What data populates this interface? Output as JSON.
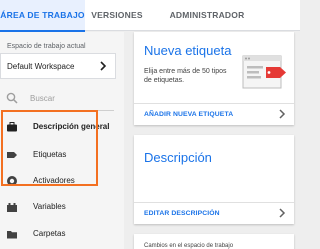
{
  "tabs": [
    {
      "label": "ÁREA DE TRABAJO",
      "active": true
    },
    {
      "label": "VERSIONES",
      "active": false
    },
    {
      "label": "ADMINISTRADOR",
      "active": false
    }
  ],
  "sidebar": {
    "workspace_label": "Espacio de trabajo actual",
    "workspace_name": "Default Workspace",
    "search_placeholder": "Buscar",
    "items": [
      {
        "label": "Descripción general",
        "icon": "briefcase-icon",
        "bold": true
      },
      {
        "label": "Etiquetas",
        "icon": "tag-icon"
      },
      {
        "label": "Activadores",
        "icon": "trigger-icon"
      },
      {
        "label": "Variables",
        "icon": "variables-icon"
      },
      {
        "label": "Carpetas",
        "icon": "folder-icon"
      }
    ],
    "highlight_color": "#f37021"
  },
  "cards": {
    "new_tag": {
      "title": "Nueva etiqueta",
      "text": "Elija entre más de 50 tipos de etiquetas.",
      "link": "AÑADIR NUEVA ETIQUETA"
    },
    "description": {
      "title": "Descripción",
      "link": "EDITAR DESCRIPCIÓN"
    },
    "bottom": {
      "text": "Cambios en el espacio de trabajo"
    }
  },
  "colors": {
    "accent": "#1a73e8",
    "highlight": "#f37021"
  }
}
